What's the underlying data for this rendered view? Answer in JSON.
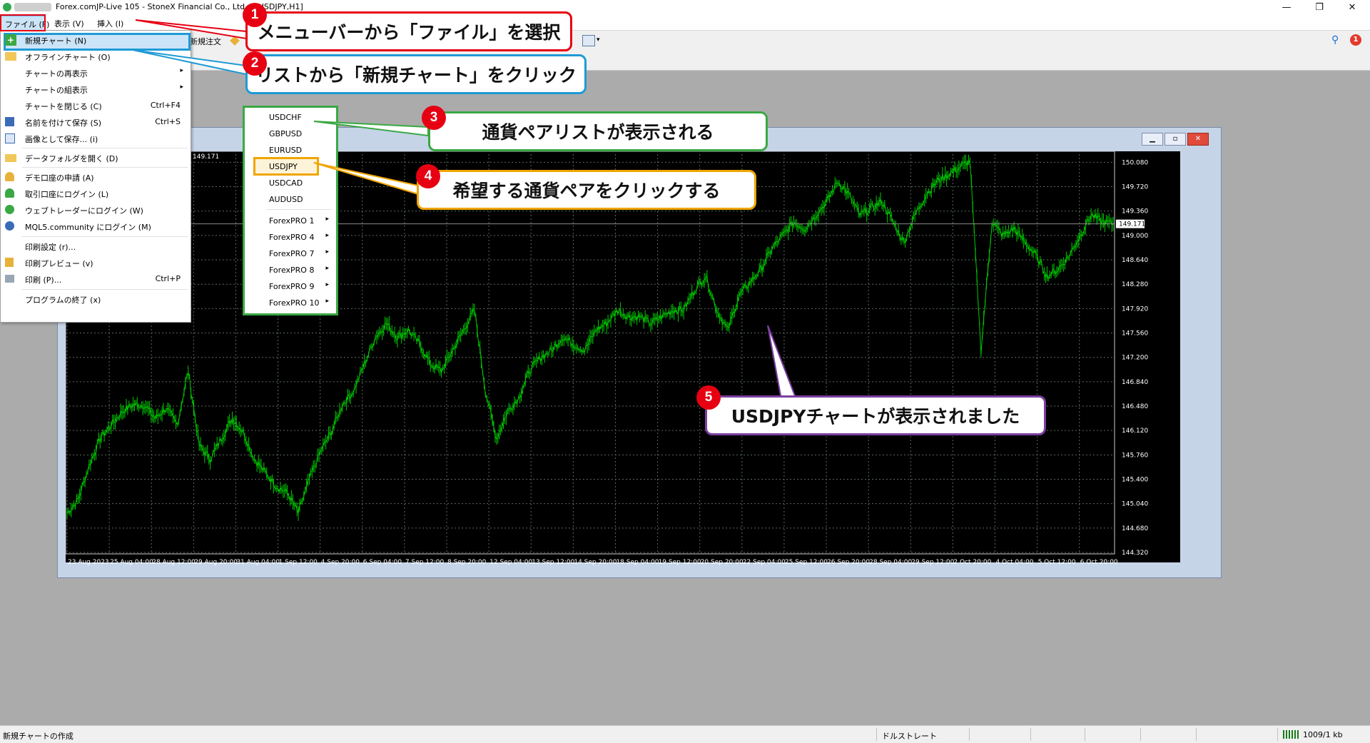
{
  "window": {
    "title": "Forex.comJP-Live 105 - StoneX Financial Co., Ltd. - [USDJPY,H1]",
    "controls": [
      "—",
      "❐",
      "✕"
    ]
  },
  "menubar": {
    "items": [
      "ファイル (F)",
      "表示 (V)",
      "挿入 (I)"
    ]
  },
  "toolbar": {
    "new_order": "新規注文"
  },
  "file_menu": {
    "items": [
      {
        "label": "新規チャート (N)",
        "shortcut": "",
        "submenu": false,
        "icon": "new-chart-icon"
      },
      {
        "label": "オフラインチャート (O)",
        "shortcut": "",
        "submenu": false,
        "icon": "folder-open-icon"
      },
      {
        "label": "チャートの再表示",
        "shortcut": "",
        "submenu": true,
        "icon": ""
      },
      {
        "label": "チャートの組表示",
        "shortcut": "",
        "submenu": true,
        "icon": ""
      },
      {
        "label": "チャートを閉じる (C)",
        "shortcut": "Ctrl+F4",
        "submenu": false,
        "icon": ""
      },
      {
        "label": "名前を付けて保存 (S)",
        "shortcut": "Ctrl+S",
        "submenu": false,
        "icon": "save-icon"
      },
      {
        "label": "画像として保存... (i)",
        "shortcut": "",
        "submenu": false,
        "icon": "image-save-icon"
      },
      {
        "label": "データフォルダを開く (D)",
        "shortcut": "",
        "submenu": false,
        "icon": "folder-icon"
      },
      {
        "label": "デモ口座の申請 (A)",
        "shortcut": "",
        "submenu": false,
        "icon": "demo-account-icon"
      },
      {
        "label": "取引口座にログイン (L)",
        "shortcut": "",
        "submenu": false,
        "icon": "login-icon"
      },
      {
        "label": "ウェブトレーダーにログイン (W)",
        "shortcut": "",
        "submenu": false,
        "icon": "webtrader-icon"
      },
      {
        "label": "MQL5.community にログイン (M)",
        "shortcut": "",
        "submenu": false,
        "icon": "mql5-icon"
      },
      {
        "label": "印刷設定 (r)...",
        "shortcut": "",
        "submenu": false,
        "icon": ""
      },
      {
        "label": "印刷プレビュー (v)",
        "shortcut": "",
        "submenu": false,
        "icon": "print-preview-icon"
      },
      {
        "label": "印刷 (P)...",
        "shortcut": "Ctrl+P",
        "submenu": false,
        "icon": "print-icon"
      },
      {
        "label": "プログラムの終了 (x)",
        "shortcut": "",
        "submenu": false,
        "icon": ""
      }
    ]
  },
  "pair_menu": {
    "items": [
      {
        "label": "USDCHF",
        "submenu": false
      },
      {
        "label": "GBPUSD",
        "submenu": false
      },
      {
        "label": "EURUSD",
        "submenu": false
      },
      {
        "label": "USDJPY",
        "submenu": false
      },
      {
        "label": "USDCAD",
        "submenu": false
      },
      {
        "label": "AUDUSD",
        "submenu": false
      },
      {
        "label": "ForexPRO 1",
        "submenu": true
      },
      {
        "label": "ForexPRO 4",
        "submenu": true
      },
      {
        "label": "ForexPRO 7",
        "submenu": true
      },
      {
        "label": "ForexPRO 8",
        "submenu": true
      },
      {
        "label": "ForexPRO 9",
        "submenu": true
      },
      {
        "label": "ForexPRO 10",
        "submenu": true
      }
    ]
  },
  "callouts": [
    {
      "num": "1",
      "text": "メニューバーから「ファイル」を選択",
      "color": "#e60012"
    },
    {
      "num": "2",
      "text": "リストから「新規チャート」をクリック",
      "color": "#1e9ad6"
    },
    {
      "num": "3",
      "text": "通貨ペアリストが表示される",
      "color": "#3aa844"
    },
    {
      "num": "4",
      "text": "希望する通貨ペアをクリックする",
      "color": "#f0a500"
    },
    {
      "num": "5",
      "text": "USDJPYチャートが表示されました",
      "color": "#7b3fa0"
    }
  ],
  "chart": {
    "header_price": "149.171",
    "current_price": "149.171",
    "candle_color": "#00c800",
    "background": "#000000",
    "grid_color": "#5a6a5a"
  },
  "chart_data": {
    "type": "line",
    "title": "",
    "xlabel": "",
    "ylabel": "",
    "x_ticks": [
      "23 Aug 2023",
      "25 Aug 04:00",
      "28 Aug 12:00",
      "29 Aug 20:00",
      "31 Aug 04:00",
      "1 Sep 12:00",
      "4 Sep 20:00",
      "6 Sep 04:00",
      "7 Sep 12:00",
      "8 Sep 20:00",
      "12 Sep 04:00",
      "13 Sep 12:00",
      "14 Sep 20:00",
      "18 Sep 04:00",
      "19 Sep 12:00",
      "20 Sep 20:00",
      "22 Sep 04:00",
      "25 Sep 12:00",
      "26 Sep 20:00",
      "28 Sep 04:00",
      "29 Sep 12:00",
      "2 Oct 20:00",
      "4 Oct 04:00",
      "5 Oct 12:00",
      "6 Oct 20:00"
    ],
    "y_ticks": [
      "150.080",
      "149.720",
      "149.360",
      "149.000",
      "148.640",
      "148.280",
      "147.920",
      "147.560",
      "147.200",
      "146.840",
      "146.480",
      "146.120",
      "145.760",
      "145.400",
      "145.040",
      "144.680",
      "144.320"
    ],
    "ylim": [
      144.32,
      150.2
    ],
    "series": [
      {
        "values": [
          144.9,
          145.1,
          145.6,
          146.0,
          146.2,
          146.4,
          146.5,
          146.5,
          146.3,
          146.45,
          146.2,
          147.0,
          145.9,
          145.7,
          146.0,
          146.3,
          146.1,
          145.7,
          145.5,
          145.3,
          145.2,
          144.9,
          145.4,
          145.8,
          146.1,
          146.5,
          146.7,
          147.1,
          147.5,
          147.7,
          147.5,
          147.6,
          147.4,
          147.1,
          147.0,
          147.3,
          147.6,
          147.9,
          146.7,
          146.0,
          146.4,
          146.6,
          147.0,
          147.2,
          147.3,
          147.5,
          147.4,
          147.3,
          147.6,
          147.7,
          147.9,
          147.8,
          147.8,
          147.7,
          147.8,
          147.9,
          147.9,
          148.2,
          148.4,
          147.9,
          147.6,
          148.1,
          148.3,
          148.5,
          148.8,
          149.0,
          149.2,
          149.1,
          149.3,
          149.5,
          149.8,
          149.6,
          149.3,
          149.4,
          149.5,
          149.2,
          148.9,
          149.3,
          149.6,
          149.8,
          149.9,
          150.0,
          150.1,
          147.3,
          149.2,
          149.0,
          149.1,
          148.9,
          148.7,
          148.4,
          148.5,
          148.7,
          149.0,
          149.3,
          149.2,
          149.17
        ]
      }
    ],
    "grid": true
  },
  "statusbar": {
    "left": "新規チャートの作成",
    "profile": "ドルストレート",
    "traffic": "1009/1 kb"
  }
}
